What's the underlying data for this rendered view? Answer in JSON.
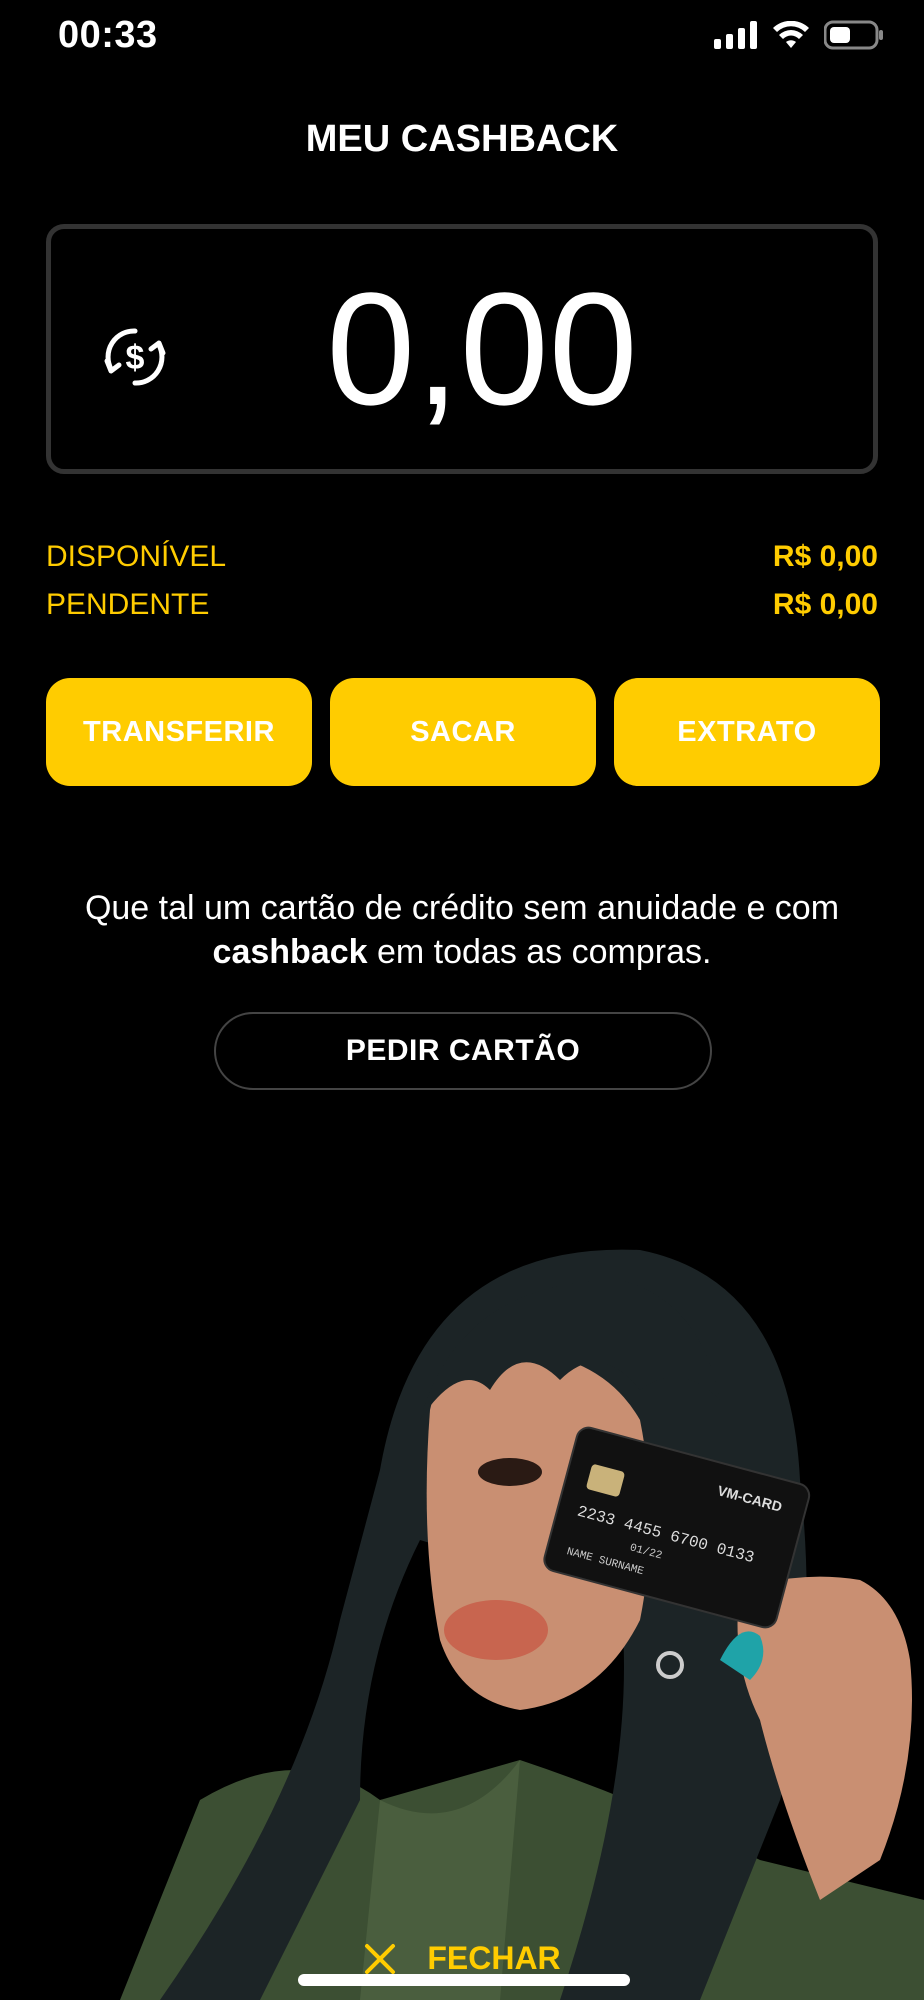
{
  "status": {
    "time": "00:33"
  },
  "header": {
    "title": "MEU CASHBACK"
  },
  "balance": {
    "value": "0,00"
  },
  "summary": {
    "available_label": "DISPONÍVEL",
    "available_value": "R$ 0,00",
    "pending_label": "PENDENTE",
    "pending_value": "R$ 0,00"
  },
  "actions": {
    "transfer": "TRANSFERIR",
    "withdraw": "SACAR",
    "statement": "EXTRATO"
  },
  "promo": {
    "line1": "Que tal um cartão de crédito sem anuidade e com",
    "bold": "cashback",
    "line2_rest": " em todas as compras.",
    "button": "PEDIR CARTÃO"
  },
  "card_image": {
    "brand": "VM-CARD",
    "number": "2233 4455 6700 0133",
    "expiry": "01/22",
    "name": "NAME SURNAME"
  },
  "footer": {
    "close_label": "FECHAR"
  },
  "colors": {
    "accent": "#FFCC00",
    "background": "#000000"
  },
  "icons": [
    "signal-icon",
    "wifi-icon",
    "battery-icon",
    "cashback-icon",
    "close-icon"
  ]
}
